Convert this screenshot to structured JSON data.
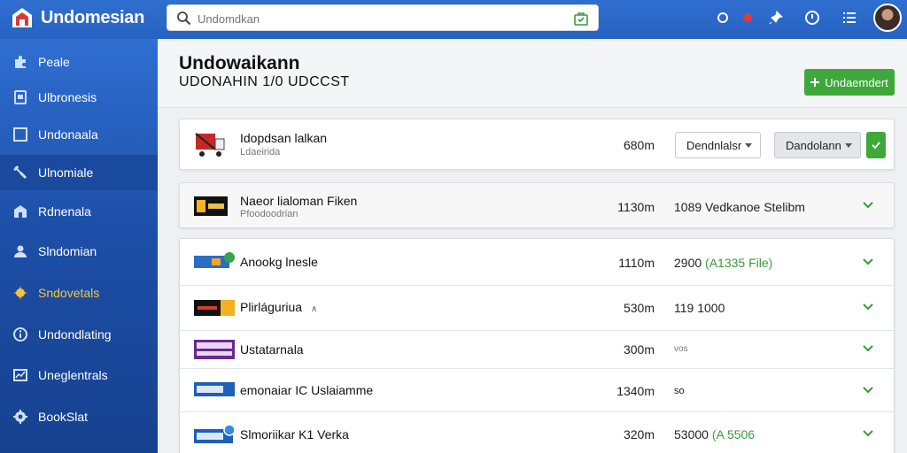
{
  "app": {
    "title": "Undomesian"
  },
  "search": {
    "placeholder": "Undomdkan"
  },
  "sidebar": {
    "items": [
      {
        "label": "Peale",
        "icon": "puzzle-icon"
      },
      {
        "label": "Ulbronesis",
        "icon": "document-icon"
      },
      {
        "label": "Undonaala",
        "icon": "square-icon"
      },
      {
        "label": "Ulnomiale",
        "icon": "tools-icon"
      },
      {
        "label": "Rdnenala",
        "icon": "building-icon"
      },
      {
        "label": "Slndomian",
        "icon": "users-icon"
      },
      {
        "label": "Sndovetals",
        "icon": "star-burst-icon"
      },
      {
        "label": "Undondlating",
        "icon": "info-icon"
      },
      {
        "label": "Uneglentrals",
        "icon": "chart-icon"
      },
      {
        "label": "BookSlat",
        "icon": "settings-icon"
      }
    ]
  },
  "page": {
    "title": "Undowaikann",
    "subtitle": "UDONAHIN 1/0 UDCCST",
    "primary_button": "Undaemdert"
  },
  "rows": [
    {
      "name": "Idopdsan lalkan",
      "sub": "Ldaeirida",
      "distance": "680m",
      "select1": "Dendnlalsr",
      "select2": "Dandolann"
    },
    {
      "name": "Naeor lialoman Fiken",
      "sub": "Pfoodoodrian",
      "distance": "1130m",
      "value": "1089  Vedkanoe Stelibm"
    },
    {
      "name": "Anookg lnesle",
      "distance": "1110m",
      "value": "2900",
      "value_green": "(A1335 File)"
    },
    {
      "name": "Plirláguriua",
      "suffix": "∧",
      "distance": "530m",
      "value": "119 1000"
    },
    {
      "name": "Ustatarnala",
      "distance": "300m",
      "value": "vos"
    },
    {
      "name": "emonaiar  IC Uslaiamme",
      "distance": "1340m",
      "value": "so"
    },
    {
      "name": "Slmoriikar  K1 Verka",
      "distance": "320m",
      "value": "53000",
      "value_green": "(A 5506"
    }
  ],
  "colors": {
    "topbar": "#2f6fd0",
    "accent_green": "#3fa83a",
    "sidebar_highlight": "#f6c435"
  }
}
